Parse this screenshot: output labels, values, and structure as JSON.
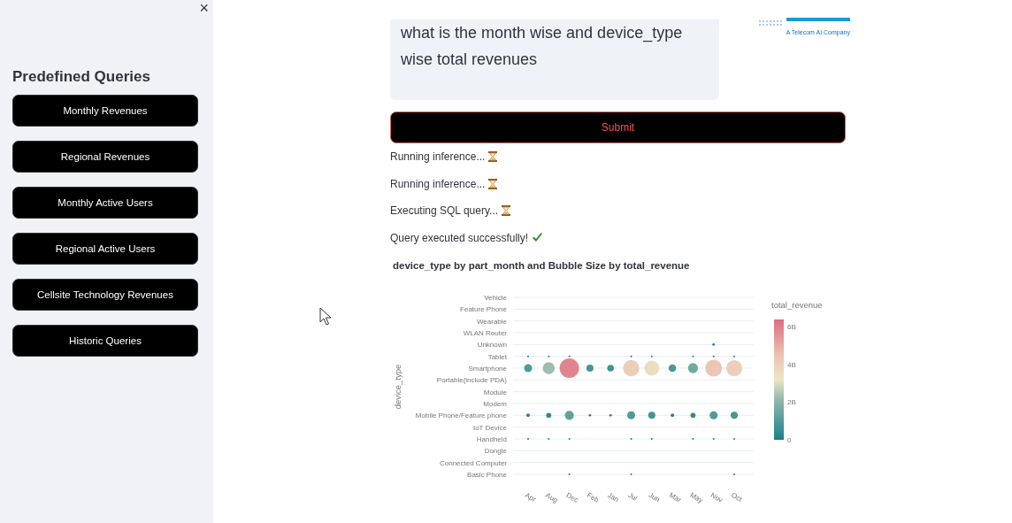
{
  "sidebar": {
    "close": "×",
    "title": "Predefined Queries",
    "buttons": [
      "Monthly Revenues",
      "Regional Revenues",
      "Monthly Active Users",
      "Regional Active Users",
      "Cellsite Technology Revenues",
      "Historic Queries"
    ]
  },
  "logo": {
    "tagline": "A Telecom AI Company"
  },
  "query": {
    "value": "what is the month wise and device_type wise total revenues"
  },
  "submit": "Submit",
  "status": [
    {
      "text": "Running inference...",
      "kind": "pending"
    },
    {
      "text": "Running inference...",
      "kind": "pending"
    },
    {
      "text": "Executing SQL query...",
      "kind": "pending"
    },
    {
      "text": "Query executed successfully!",
      "kind": "done"
    }
  ],
  "chart": {
    "title": "device_type by part_month and Bubble Size by total_revenue",
    "y_axis_title": "device_type",
    "rows": [
      "Vehicle",
      "Feature Phone",
      "Wearable",
      "WLAN Router",
      "Unknown",
      "Tablet",
      "Smartphone",
      "Portable(include PDA)",
      "Module",
      "Modem",
      "Mobile Phone/Feature phone",
      "IoT Device",
      "Handheld",
      "Dongle",
      "Connected Computer",
      "Basic Phone"
    ],
    "months": [
      "Apr",
      "Aug",
      "Dec",
      "Feb",
      "Jan",
      "Jul",
      "Jun",
      "Mar",
      "May",
      "Nov",
      "Oct"
    ],
    "colorbar": {
      "title": "total_revenue",
      "ticks": [
        "6B",
        "4B",
        "2B",
        "0"
      ]
    }
  }
}
